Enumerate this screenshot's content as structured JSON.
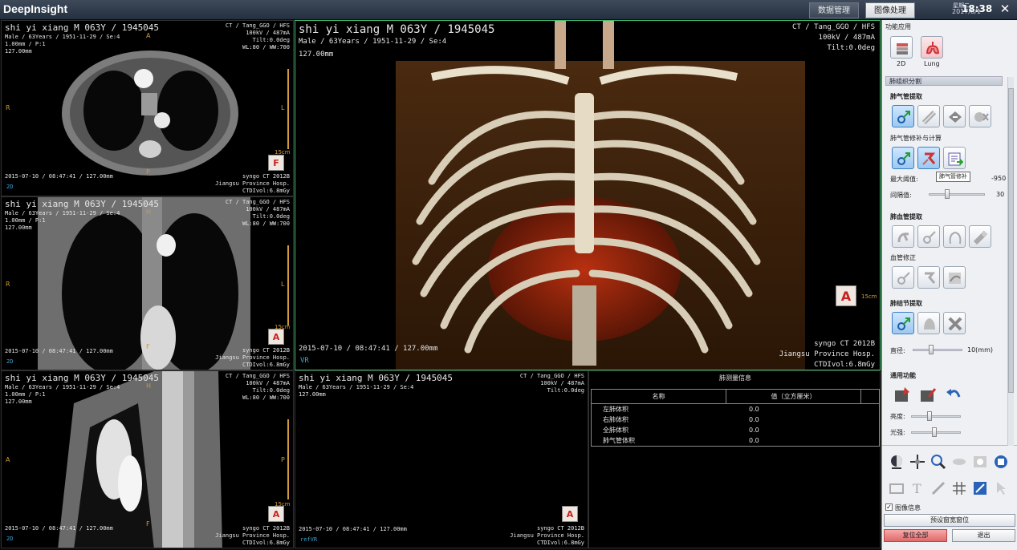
{
  "app": {
    "title": "DeepInsight"
  },
  "tabs": [
    {
      "label": "数据管理"
    },
    {
      "label": "图像处理"
    }
  ],
  "clock": {
    "weekday": "星期二",
    "date": "2017/8/1",
    "time": "18:38"
  },
  "close_symbol": "✕",
  "patient": {
    "name_line": "shi yi xiang  M 063Y / 1945045",
    "demo_line": "Male / 63Years / 1951-11-29 / Se:4",
    "slice_line": "1.00mm / P:1",
    "thickness": "127.00mm",
    "study_line": "2015-07-10 / 08:47:41 / 127.00mm",
    "ct_line": "CT / Tang_GGO / HFS",
    "kv_line": "100kV / 487mA",
    "tilt_line": "Tilt:0.0deg",
    "wl_line": "WL:80 / WW:700",
    "scanner_line": "syngo CT 2012B",
    "hosp_line": "Jiangsu Province Hosp.",
    "ctdi_line": "CTDIvol:6.8mGy"
  },
  "viewports": {
    "axial": {
      "mode": "2D",
      "left": "R",
      "right": "L",
      "top": "A",
      "bottom": "P",
      "cube": "F",
      "scale": "15cm"
    },
    "coronal": {
      "mode": "2D",
      "left": "R",
      "right": "L",
      "top": "H",
      "bottom": "F",
      "cube": "A",
      "scale": "15cm"
    },
    "sagittal": {
      "mode": "2D",
      "left": "A",
      "right": "P",
      "top": "H",
      "bottom": "F",
      "cube": "A",
      "scale": "15cm"
    },
    "vr": {
      "mode": "VR",
      "cube": "A",
      "scale": "15cm"
    },
    "refvr": {
      "mode": "refVR",
      "cube": "A"
    }
  },
  "lung_table": {
    "title": "肺测量信息",
    "col_name": "名称",
    "col_value": "值（立方厘米）",
    "rows": [
      {
        "name": "左肺体积",
        "value": "0.0"
      },
      {
        "name": "右肺体积",
        "value": "0.0"
      },
      {
        "name": "全肺体积",
        "value": "0.0"
      },
      {
        "name": "肺气管体积",
        "value": "0.0"
      }
    ]
  },
  "panel": {
    "func_app": "功能应用",
    "app_2d": "2D",
    "app_lung": "Lung",
    "section": "肺组织分割",
    "airway_extract": "肺气管提取",
    "airway_repair": "肺气管修补与计算",
    "max_threshold_label": "最大阈值:",
    "max_threshold_value": "-950",
    "interval_label": "间隔值:",
    "interval_value": "30",
    "tooltip": "肺气管修补",
    "vessel_extract": "肺血管提取",
    "vessel_repair": "血管修正",
    "nodule_extract": "肺结节提取",
    "diameter_label": "直径:",
    "diameter_value": "10(mm)",
    "general": "通用功能",
    "brightness": "亮度:",
    "light": "光强:",
    "image_info": "图像信息",
    "preset_btn": "预设窗宽窗位",
    "reset_btn": "复位全部",
    "exit_btn": "退出"
  },
  "colors": {
    "accent_green": "#3fbf6a",
    "orientation": "#d09a3a",
    "mode": "#3aa3d8"
  }
}
